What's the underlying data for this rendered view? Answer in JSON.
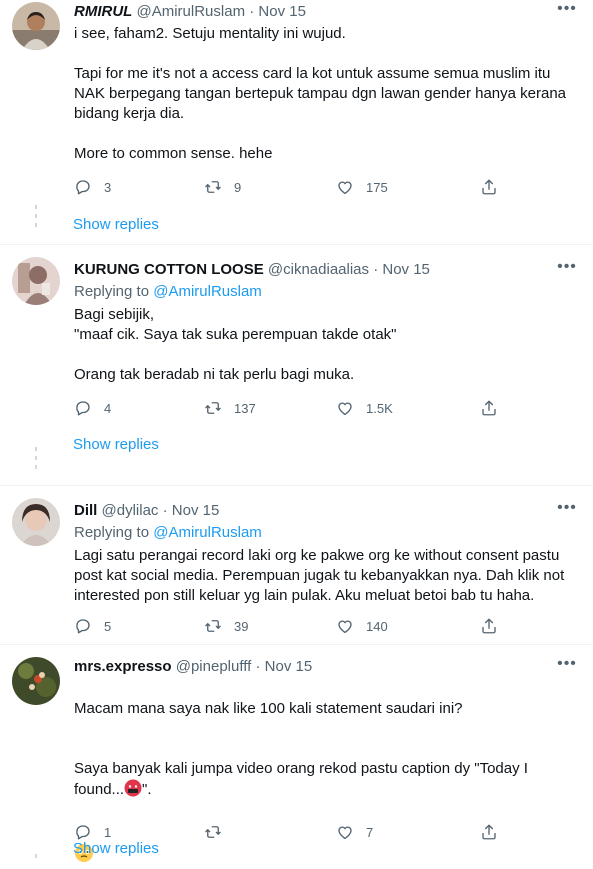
{
  "tweets": [
    {
      "name": "RMIRUL",
      "handle": "@AmirulRuslam",
      "sep": "·",
      "date": "Nov 15",
      "body": "i see, faham2. Setuju mentality ini wujud.\n\nTapi for me it's not a access card la kot untuk assume semua muslim itu NAK berpegang tangan bertepuk tampau dgn lawan gender hanya kerana bidang kerja dia.\n\nMore to common sense. hehe",
      "replies": "3",
      "retweets": "9",
      "likes": "175",
      "show_replies": "Show replies"
    },
    {
      "name": "KURUNG COTTON LOOSE",
      "handle": "@ciknadiaalias",
      "sep": "·",
      "date": "Nov 15",
      "replying_prefix": "Replying to",
      "replying_to": "@AmirulRuslam",
      "body": "Bagi sebijik,\n\"maaf cik. Saya tak suka perempuan takde otak\"\n\nOrang tak beradab ni tak perlu bagi muka.",
      "replies": "4",
      "retweets": "137",
      "likes": "1.5K",
      "show_replies": "Show replies"
    },
    {
      "name": "Dill",
      "handle": "@dylilac",
      "sep": "·",
      "date": "Nov 15",
      "replying_prefix": "Replying to",
      "replying_to": "@AmirulRuslam",
      "body": "Lagi satu perangai record laki org ke pakwe org ke without consent pastu post kat social media. Perempuan jugak tu kebanyakkan nya. Dah klik not interested pon still keluar yg lain pulak. Aku meluat betoi bab tu haha.",
      "replies": "5",
      "retweets": "39",
      "likes": "140"
    },
    {
      "name": "mrs.expresso",
      "handle": "@pineplufff",
      "sep": "·",
      "date": "Nov 15",
      "body_line1": "Macam mana saya nak like 100 kali statement saudari ini?",
      "body_line2_prefix": "Saya banyak kali jumpa video orang rekod pastu caption dy \"Today I found...",
      "body_line2_suffix": "\".",
      "replies": "1",
      "likes": "7",
      "show_replies": "Show replies"
    }
  ],
  "icons": [
    "reply-icon",
    "retweet-icon",
    "like-icon",
    "share-icon",
    "more-icon"
  ],
  "colors": {
    "link": "#1d9bf0",
    "secondary": "#536471",
    "divider": "#eff3f4",
    "thread_line": "#cfd9de"
  }
}
